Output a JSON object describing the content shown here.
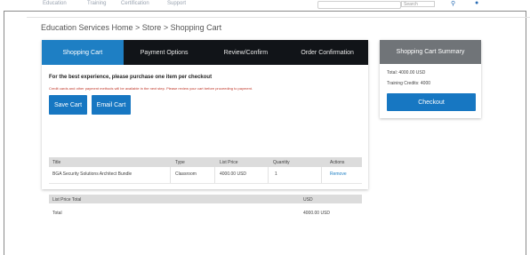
{
  "topnav": {
    "links": [
      "Education",
      "Training",
      "Certification",
      "Support"
    ],
    "search_placeholder": "",
    "search_scope": "Search"
  },
  "breadcrumb": "Education Services Home > Store > Shopping Cart",
  "tabs": [
    {
      "label": "Shopping Cart",
      "active": true
    },
    {
      "label": "Payment Options",
      "active": false
    },
    {
      "label": "Review/Confirm",
      "active": false
    },
    {
      "label": "Order Confirmation",
      "active": false
    }
  ],
  "cart": {
    "best_experience": "For the best experience, please purchase one item per checkout",
    "note": "Credit cards and other payment methods will be available in the next step. Please review your cart before proceeding to payment.",
    "save_label": "Save Cart",
    "email_label": "Email Cart",
    "items_columns": [
      "Title",
      "Type",
      "List Price",
      "Quantity",
      "Actions"
    ],
    "items": [
      {
        "title": "BGA Security Solutions Architect Bundle",
        "type": "Classroom",
        "price": "4000.00 USD",
        "quantity": "1",
        "action": "Remove"
      }
    ],
    "totals_columns": [
      "List Price Total",
      "USD"
    ],
    "totals": [
      {
        "label": "Total",
        "value": "4000.00 USD"
      }
    ]
  },
  "summary": {
    "title": "Shopping Cart Summary",
    "total": "Total: 4000.00 USD",
    "credits": "Training Credits: 4000",
    "checkout_label": "Checkout"
  },
  "colors": {
    "accent": "#1777c2",
    "tab_bar": "#111418",
    "summary_header": "#707478"
  }
}
